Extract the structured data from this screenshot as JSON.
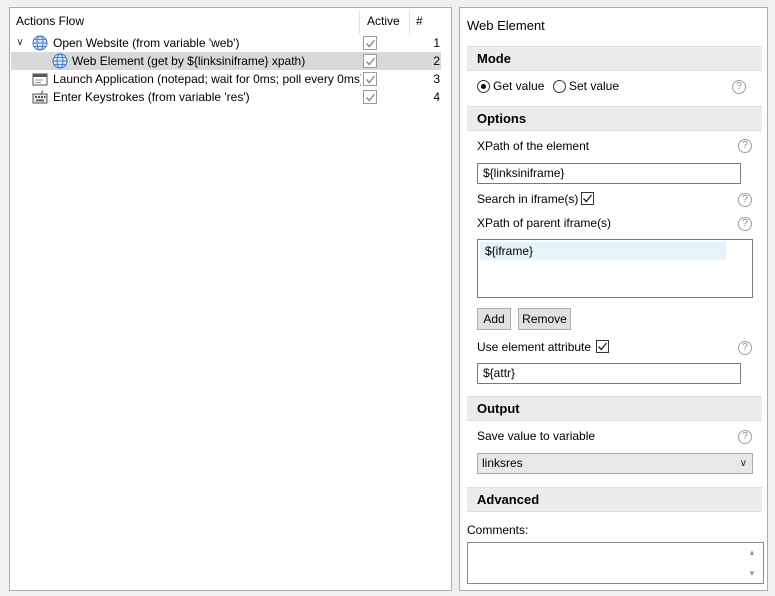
{
  "tree": {
    "headers": {
      "flow": "Actions Flow",
      "active": "Active",
      "number": "#"
    },
    "rows": [
      {
        "label": "Open Website (from variable 'web')",
        "number": "1",
        "icon": "globe-icon",
        "active": true
      },
      {
        "label": "Web Element (get by ${linksiniframe} xpath)",
        "number": "2",
        "icon": "globe-icon",
        "active": true
      },
      {
        "label": "Launch Application (notepad; wait for 0ms; poll every 0ms)",
        "number": "3",
        "icon": "application-window-icon",
        "active": true
      },
      {
        "label": "Enter Keystrokes (from variable 'res')",
        "number": "4",
        "icon": "keyboard-icon",
        "active": true
      }
    ]
  },
  "panel": {
    "title": "Web Element",
    "mode": {
      "heading": "Mode",
      "get_label": "Get value",
      "set_label": "Set value",
      "selected": "get"
    },
    "options": {
      "heading": "Options",
      "xpath_label": "XPath of the element",
      "xpath_value": "${linksiniframe}",
      "search_iframe_label": "Search in iframe(s)",
      "search_iframe_checked": true,
      "parent_iframe_label": "XPath of parent iframe(s)",
      "iframe_items": [
        "${iframe}"
      ],
      "add_label": "Add",
      "remove_label": "Remove",
      "use_attr_label": "Use element attribute",
      "use_attr_checked": true,
      "attr_value": "${attr}"
    },
    "output": {
      "heading": "Output",
      "save_label": "Save value to variable",
      "variable": "linksres"
    },
    "advanced": {
      "heading": "Advanced"
    },
    "comments": {
      "label": "Comments:",
      "value": ""
    },
    "help_glyph": "?"
  },
  "colors": {
    "selected_row": "#d9d9d9",
    "section_bg": "#ececec",
    "list_highlight": "#e5f3fb",
    "globe_blue": "#3c6fc4"
  }
}
